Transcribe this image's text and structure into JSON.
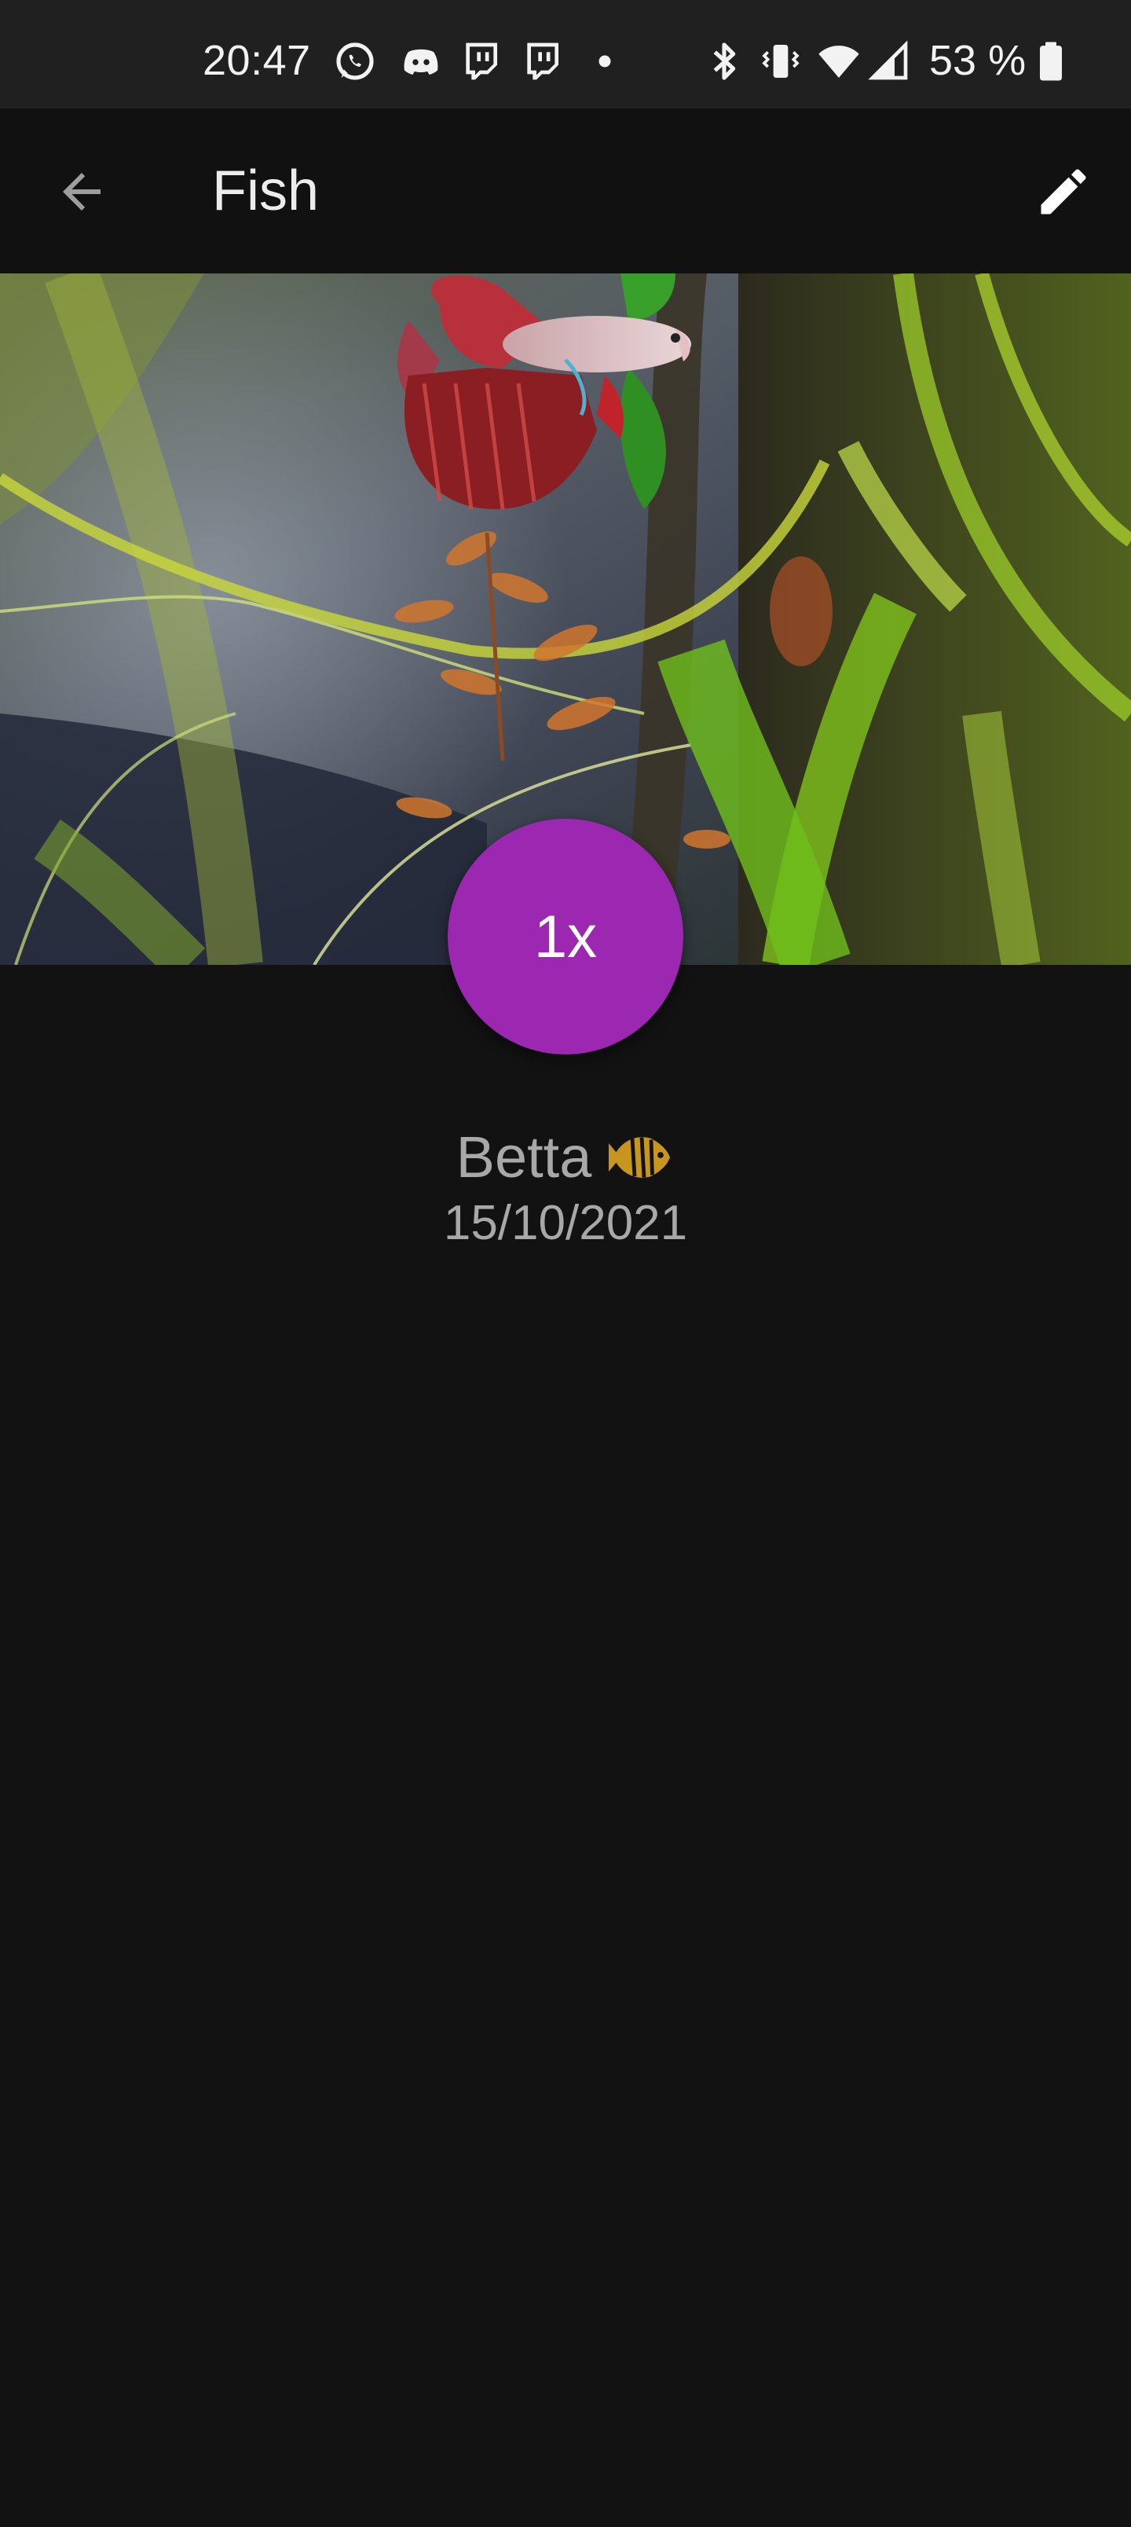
{
  "status_bar": {
    "time": "20:47",
    "notification_icons": [
      "whatsapp-icon",
      "discord-icon",
      "twitch-icon",
      "twitch-icon",
      "dot-icon"
    ],
    "system_icons": [
      "bluetooth-icon",
      "vibrate-icon",
      "wifi-icon",
      "cell-signal-icon"
    ],
    "battery_percent": "53 %"
  },
  "app_bar": {
    "title": "Fish",
    "back_icon": "arrow-back-icon",
    "edit_icon": "pencil-icon"
  },
  "hero": {
    "image_subject": "betta-fish-aquarium-photo"
  },
  "fab": {
    "label": "1x"
  },
  "details": {
    "species": "Betta",
    "species_icon": "tropical-fish-icon",
    "date": "15/10/2021"
  },
  "colors": {
    "background": "#121212",
    "status_bar": "#202020",
    "app_bar": "#111111",
    "fab": "#9c27b0",
    "fish_icon": "#c8961e"
  }
}
